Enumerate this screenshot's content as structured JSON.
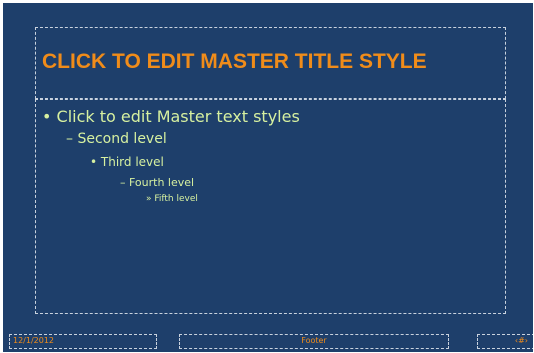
{
  "title": {
    "text": "CLICK TO EDIT MASTER TITLE STYLE"
  },
  "body": {
    "levels": [
      "• Click to edit Master text styles",
      "– Second level",
      "• Third level",
      "– Fourth level",
      "» Fifth level"
    ]
  },
  "footer": {
    "date": "12/1/2012",
    "footer": "Footer",
    "slide_number": "‹#›"
  },
  "colors": {
    "background": "#1e3f6b",
    "title": "#f08c1a",
    "body_text": "#d6f0a0",
    "placeholder_border": "#c9d2de"
  }
}
